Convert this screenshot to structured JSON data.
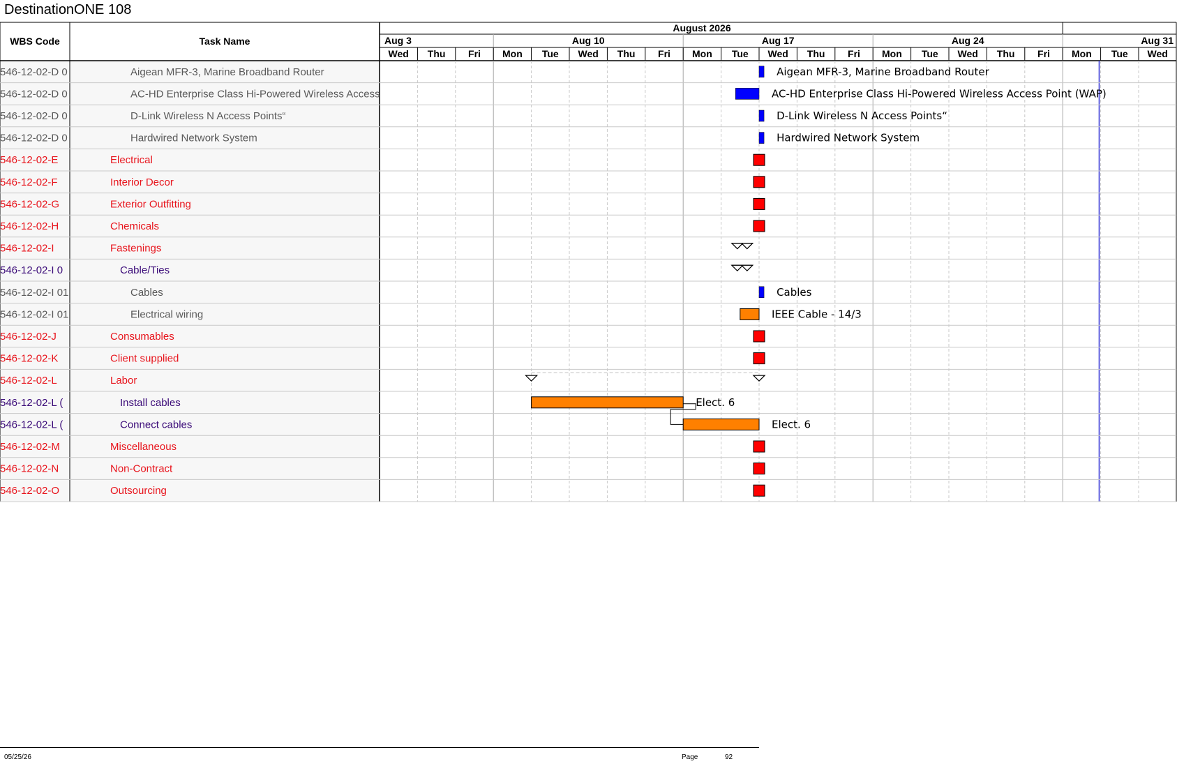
{
  "app_title": "DestinationONE 108",
  "header": {
    "wbs_col": "WBS Code",
    "task_col": "Task Name",
    "month": "August 2026",
    "weeks": [
      "Aug 3",
      "Aug 10",
      "Aug 17",
      "Aug 24",
      "Aug 31"
    ],
    "days": [
      "Wed",
      "Thu",
      "Fri",
      "Mon",
      "Tue",
      "Wed",
      "Thu",
      "Fri",
      "Mon",
      "Tue",
      "Wed",
      "Thu",
      "Fri",
      "Mon",
      "Tue",
      "Wed",
      "Thu",
      "Fri",
      "Mon",
      "Tue",
      "Wed"
    ]
  },
  "colors": {
    "gray_text": "#595959",
    "red_text": "#e8141c",
    "purple_text": "#3a0a78",
    "blue_bar": "#0000ff",
    "red_bar": "#ff0000",
    "orange_bar": "#ff8000",
    "today_line": "#3b3bd6",
    "grid": "#c8c8c8"
  },
  "rows": [
    {
      "wbs": "546-12-02-D 0",
      "task": "Aigean MFR-3, Marine Broadband Router",
      "style": "gray",
      "indent": 3,
      "bar": "blue",
      "start_day": 10.0,
      "end_day": 10.13,
      "label": "Aigean MFR-3, Marine Broadband Router"
    },
    {
      "wbs": "546-12-02-D 0",
      "task": "AC-HD Enterprise Class Hi-Powered Wireless Access",
      "style": "gray",
      "indent": 3,
      "bar": "blue",
      "start_day": 9.38,
      "end_day": 10.0,
      "label": "AC-HD Enterprise Class Hi-Powered Wireless Access Point (WAP)"
    },
    {
      "wbs": "546-12-02-D 0",
      "task": "D-Link Wireless N Access Points“",
      "style": "gray",
      "indent": 3,
      "bar": "blue",
      "start_day": 10.0,
      "end_day": 10.13,
      "label": "D-Link Wireless N Access Points“"
    },
    {
      "wbs": "546-12-02-D 0",
      "task": "Hardwired Network System",
      "style": "gray",
      "indent": 3,
      "bar": "blue",
      "start_day": 10.0,
      "end_day": 10.13,
      "label": "Hardwired Network System"
    },
    {
      "wbs": "546-12-02-E",
      "task": "Electrical",
      "style": "red",
      "indent": 1,
      "bar": "milestone",
      "start_day": 10.0,
      "end_day": 10.0,
      "label": ""
    },
    {
      "wbs": "546-12-02-F",
      "task": "Interior Decor",
      "style": "red",
      "indent": 1,
      "bar": "milestone",
      "start_day": 10.0,
      "end_day": 10.0,
      "label": ""
    },
    {
      "wbs": "546-12-02-G",
      "task": "Exterior Outfitting",
      "style": "red",
      "indent": 1,
      "bar": "milestone",
      "start_day": 10.0,
      "end_day": 10.0,
      "label": ""
    },
    {
      "wbs": "546-12-02-H",
      "task": "Chemicals",
      "style": "red",
      "indent": 1,
      "bar": "milestone",
      "start_day": 10.0,
      "end_day": 10.0,
      "label": ""
    },
    {
      "wbs": "546-12-02-I",
      "task": "Fastenings",
      "style": "red",
      "indent": 1,
      "bar": "summary",
      "start_day": 9.5,
      "end_day": 10.0,
      "label": ""
    },
    {
      "wbs": "546-12-02-I 0",
      "task": "Cable/Ties",
      "style": "purple",
      "indent": 2,
      "bar": "summary",
      "start_day": 9.5,
      "end_day": 10.0,
      "label": ""
    },
    {
      "wbs": "546-12-02-I 01",
      "task": "Cables",
      "style": "gray",
      "indent": 3,
      "bar": "blue",
      "start_day": 10.0,
      "end_day": 10.13,
      "label": "Cables"
    },
    {
      "wbs": "546-12-02-I 01",
      "task": "Electrical wiring",
      "style": "gray",
      "indent": 3,
      "bar": "orange",
      "start_day": 9.5,
      "end_day": 10.0,
      "label": "IEEE Cable - 14/3"
    },
    {
      "wbs": "546-12-02-J",
      "task": "Consumables",
      "style": "red",
      "indent": 1,
      "bar": "milestone",
      "start_day": 10.0,
      "end_day": 10.0,
      "label": ""
    },
    {
      "wbs": "546-12-02-K",
      "task": "Client supplied",
      "style": "red",
      "indent": 1,
      "bar": "milestone",
      "start_day": 10.0,
      "end_day": 10.0,
      "label": ""
    },
    {
      "wbs": "546-12-02-L",
      "task": "Labor",
      "style": "red",
      "indent": 1,
      "bar": "summary",
      "start_day": 4.0,
      "end_day": 10.0,
      "label": ""
    },
    {
      "wbs": "546-12-02-L (",
      "task": "Install cables",
      "style": "purple",
      "indent": 2,
      "bar": "orange",
      "start_day": 4.0,
      "end_day": 8.0,
      "label": "Elect. 6"
    },
    {
      "wbs": "546-12-02-L (",
      "task": "Connect cables",
      "style": "purple",
      "indent": 2,
      "bar": "orange",
      "start_day": 8.0,
      "end_day": 10.0,
      "label": "Elect. 6"
    },
    {
      "wbs": "546-12-02-M",
      "task": "Miscellaneous",
      "style": "red",
      "indent": 1,
      "bar": "milestone",
      "start_day": 10.0,
      "end_day": 10.0,
      "label": ""
    },
    {
      "wbs": "546-12-02-N",
      "task": "Non-Contract",
      "style": "red",
      "indent": 1,
      "bar": "milestone",
      "start_day": 10.0,
      "end_day": 10.0,
      "label": ""
    },
    {
      "wbs": "546-12-02-O",
      "task": "Outsourcing",
      "style": "red",
      "indent": 1,
      "bar": "milestone",
      "start_day": 10.0,
      "end_day": 10.0,
      "label": ""
    }
  ],
  "footer": {
    "date": "05/25/26",
    "page_label": "Page",
    "page_number": "92"
  }
}
